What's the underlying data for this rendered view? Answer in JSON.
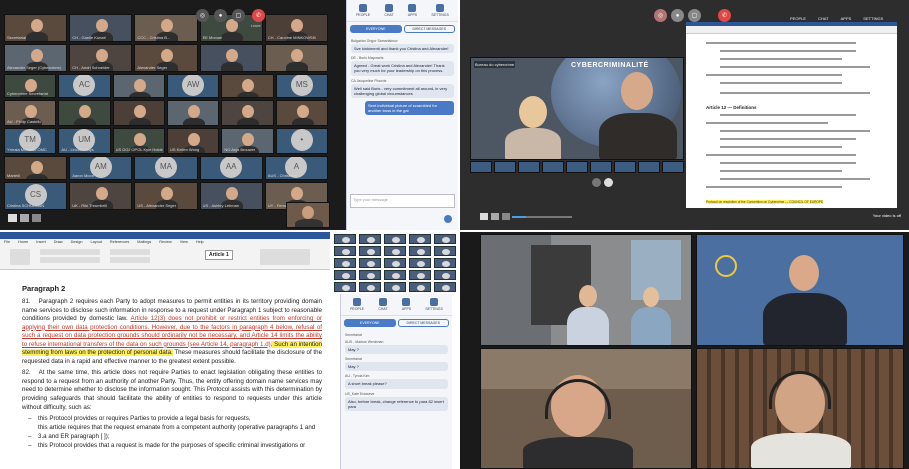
{
  "colors": {
    "accent": "#4a7ac5",
    "dark": "#1b1b1b",
    "highlight": "#ffef5a",
    "redtext": "#c0392b"
  },
  "q1": {
    "tiles": [
      {
        "name": "Secretariat",
        "type": "video"
      },
      {
        "name": "CH - Gaelle Kunzel",
        "type": "video"
      },
      {
        "name": "CCC - Cristina B...",
        "type": "video"
      },
      {
        "name": "EE Monoel",
        "type": "video"
      },
      {
        "name": "CH - Caroline MINKOWSKI",
        "type": "video"
      },
      {
        "name": "Alexander Seger (Cybercrime)",
        "type": "video"
      },
      {
        "name": "CH - Andri Schneider",
        "type": "video"
      },
      {
        "name": "Alexander Seger",
        "type": "video"
      },
      {
        "name": "",
        "type": "video"
      },
      {
        "name": "",
        "type": "video"
      },
      {
        "name": "Cybercrime Secretariat",
        "type": "video"
      },
      {
        "name": "",
        "type": "avatar",
        "initials": "AC"
      },
      {
        "name": "",
        "type": "video"
      },
      {
        "name": "",
        "type": "avatar",
        "initials": "AW"
      },
      {
        "name": "",
        "type": "video"
      },
      {
        "name": "",
        "type": "avatar",
        "initials": "MS"
      },
      {
        "name": "AU - Philip Castello",
        "type": "video"
      },
      {
        "name": "",
        "type": "video"
      },
      {
        "name": "",
        "type": "video"
      },
      {
        "name": "",
        "type": "video"
      },
      {
        "name": "",
        "type": "video"
      },
      {
        "name": "",
        "type": "video"
      },
      {
        "name": "Yrmala Mercado OMC",
        "type": "avatar",
        "initials": "TM"
      },
      {
        "name": "AU - Lincoln Mays",
        "type": "avatar",
        "initials": "UM"
      },
      {
        "name": "US DOJ OPOL Kyle Holder",
        "type": "video"
      },
      {
        "name": "US Kellen Wong",
        "type": "video"
      },
      {
        "name": "NO Anja Brouwer",
        "type": "video"
      },
      {
        "name": "",
        "type": "avatar",
        "initials": "•"
      },
      {
        "name": "Martelli",
        "type": "video"
      },
      {
        "name": "Aaron Moon",
        "type": "avatar",
        "initials": "AM"
      },
      {
        "name": "",
        "type": "avatar",
        "initials": "MA"
      },
      {
        "name": "",
        "type": "avatar",
        "initials": "AA"
      },
      {
        "name": "AUS - Christofor",
        "type": "avatar",
        "initials": "A"
      },
      {
        "name": "Cristina SCHULMAN",
        "type": "avatar",
        "initials": "CS"
      },
      {
        "name": "UK - Riki Thrumbrill",
        "type": "video"
      },
      {
        "name": "US - Alexander Seger",
        "type": "video"
      },
      {
        "name": "US - Ashley Lehman",
        "type": "video"
      },
      {
        "name": "UY - Fernando",
        "type": "video"
      }
    ],
    "toolbar": {
      "leave": "Leave"
    },
    "chat": {
      "top": [
        "PEOPLE",
        "CHAT",
        "APPS",
        "SETTINGS"
      ],
      "tabs": [
        "EVERYONE",
        "DIRECT MESSAGES"
      ],
      "messages": [
        {
          "who": "Bulgarian Grigor Samarlaksov",
          "text": "Sve kinkimenti and thank you Cristina and Alexander!",
          "me": false
        },
        {
          "who": "DE - Boris Mayoweis",
          "text": "Agreed - Great work Cristina and Alexander! Thank you very much for your leadership on this process.",
          "me": false
        },
        {
          "who": "CA Jacqueline Plourde",
          "text": "Well said Boris - very commitment all around, in very challenging global circumstances",
          "me": false
        },
        {
          "who": "",
          "text": "Sent individual picture of scrambled for another boss in the gal",
          "me": true
        }
      ],
      "placeholder": "Type your message"
    }
  },
  "q2": {
    "toolbar": [
      "PEOPLE",
      "CHAT",
      "APPS",
      "SETTINGS"
    ],
    "banner": "CYBERCRIMINALITÉ",
    "subtitle": "Bureau du cybercrime",
    "doc": {
      "heading": "Article 12 — Definitions",
      "footer": "Protocol on resolution of the Convention on Cybercrime — COUNCIL OF EUROPE",
      "caption": "Your video is off"
    }
  },
  "q3": {
    "ribbon_tabs": [
      "File",
      "Home",
      "Insert",
      "Draw",
      "Design",
      "Layout",
      "References",
      "Mailings",
      "Review",
      "View",
      "Help"
    ],
    "style_label": "Article 1",
    "heading": "Paragraph 2",
    "paras": [
      {
        "n": "81.",
        "pre": "Paragraph 2 requires each Party to adopt measures to permit entities in its territory providing domain name services to disclose such information in response to a request under Paragraph 1 subject to reasonable conditions provided by domestic law.",
        "red": "Article 12(3) does not prohibit or restrict entities from enforcing or applying their own data protection conditions. However, due to the factors in paragraph 4 below, refusal of such a request on data protection grounds should ordinarily not be necessary, and Article 14 limits the ability to refuse international transfers of the data on such grounds (see Article 14, paragraph 1.d)",
        "hl": ". Such an intention stemming from laws on the protection of personal data.",
        "post": " These measures should facilitate the disclosure of the requested data in a rapid and effective manner to the greatest extent possible."
      },
      {
        "n": "82.",
        "pre": "At the same time, this article does not require Parties to enact legislation obligating these entities to respond to a request from an authority of another Party. Thus, the entity offering domain name services may need to determine whether to disclose the information sought. This Protocol assists with this determination by providing safeguards that should facilitate the ability of entities to respond to requests under this article without difficulty, such as:",
        "red": "",
        "hl": "",
        "post": ""
      }
    ],
    "bullets": [
      "this Protocol provides or requires Parties to provide a legal basis for requests,",
      "this article requires that the request emanate from a competent authority (operative paragraphs 1 and 3.a and ER paragraph [ ]);",
      "this Protocol provides that a request is made for the purposes of specific criminal investigations or"
    ],
    "chat": {
      "top": [
        "PEOPLE",
        "CHAT",
        "APPS",
        "SETTINGS"
      ],
      "tabs": [
        "EVERYONE",
        "DIRECT MESSAGES"
      ],
      "messages": [
        {
          "who": "Secretariat",
          "text": "",
          "me": false
        },
        {
          "who": "AUS - Markus Wenkman",
          "text": "May ?",
          "me": false
        },
        {
          "who": "Secretariat",
          "text": "May ?",
          "me": false
        },
        {
          "who": "AU - Tyrola Kim",
          "text": "A short break please?",
          "me": false
        },
        {
          "who": "US_Kate Eniaseve",
          "text": "Also, before break, change reference to para 82 insert para",
          "me": false
        }
      ]
    }
  },
  "q4": {
    "tiles": [
      {
        "name": ""
      },
      {
        "name": ""
      },
      {
        "name": ""
      },
      {
        "name": ""
      }
    ]
  }
}
